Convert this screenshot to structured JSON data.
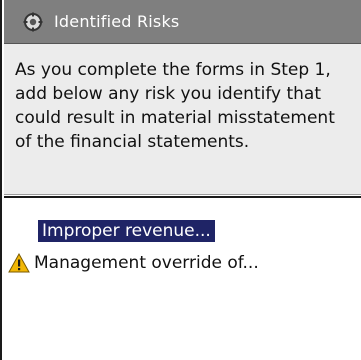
{
  "panel": {
    "title": "Identified Risks",
    "title_icon": "gear-icon",
    "description": "As you complete the forms in Step 1, add below any risk you identify that could result in material misstatement of the financial statements."
  },
  "risks": [
    {
      "label": "Improper revenue...",
      "selected": true,
      "icon": null
    },
    {
      "label": "Management override of...",
      "selected": false,
      "icon": "warning-icon"
    }
  ],
  "colors": {
    "titlebar": "#7f7f7f",
    "selection": "#1f2466",
    "warning": "#f2b705"
  }
}
